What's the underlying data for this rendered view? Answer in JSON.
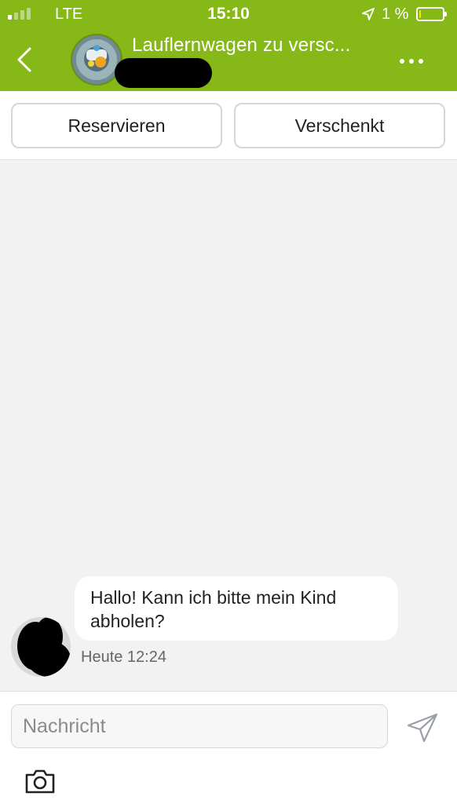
{
  "status_bar": {
    "network": "LTE",
    "time": "15:10",
    "battery_percent": "1 %",
    "battery_level": 0.03,
    "signal_bars_active": 1,
    "signal_bars_total": 4
  },
  "header": {
    "title": "Lauflernwagen zu versc...",
    "background": "#86b817"
  },
  "actions": {
    "reserve_label": "Reservieren",
    "gift_label": "Verschenkt"
  },
  "messages": [
    {
      "text": "Hallo!  Kann ich bitte mein Kind abholen?",
      "time": "Heute 12:24"
    }
  ],
  "composer": {
    "placeholder": "Nachricht",
    "value": ""
  },
  "icons": {
    "back": "chevron-left-icon",
    "more": "ellipsis-icon",
    "send": "paper-plane-icon",
    "camera": "camera-icon",
    "location": "location-arrow-icon"
  }
}
